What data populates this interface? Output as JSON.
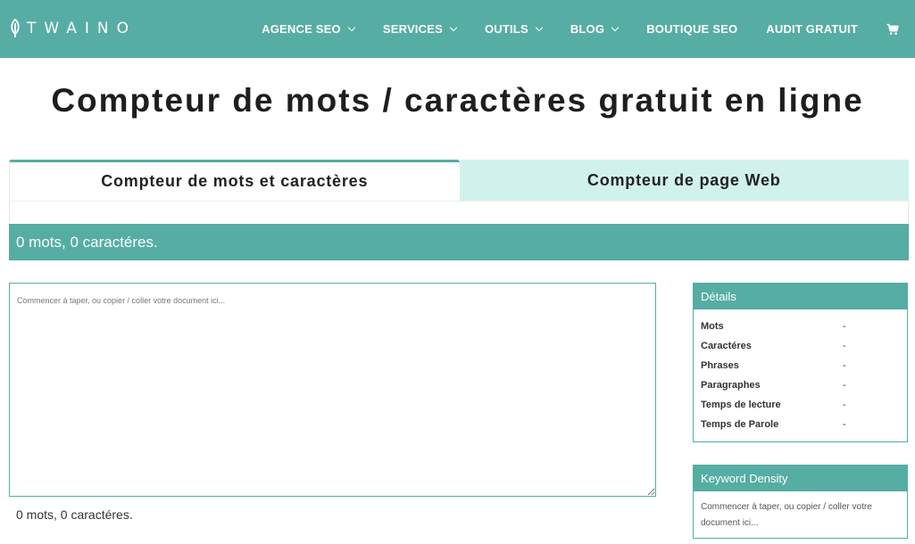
{
  "header": {
    "logo_text": "TWAINO",
    "nav": [
      {
        "label": "AGENCE SEO",
        "dropdown": true
      },
      {
        "label": "SERVICES",
        "dropdown": true
      },
      {
        "label": "OUTILS",
        "dropdown": true
      },
      {
        "label": "BLOG",
        "dropdown": true
      },
      {
        "label": "BOUTIQUE SEO",
        "dropdown": false
      },
      {
        "label": "AUDIT GRATUIT",
        "dropdown": false
      }
    ],
    "cart_icon": "shopping-cart-icon"
  },
  "page": {
    "title": "Compteur de mots / caractères gratuit en ligne"
  },
  "tabs": [
    {
      "label": "Compteur de mots et caractères",
      "active": true
    },
    {
      "label": "Compteur de page Web",
      "active": false
    }
  ],
  "counter": {
    "summary": "0 mots, 0 caractéres.",
    "textarea_placeholder": "Commencer à taper, ou copier / coller votre document ici...",
    "bottom_summary": "0 mots, 0 caractéres."
  },
  "details": {
    "title": "Détails",
    "rows": [
      {
        "label": "Mots",
        "value": "-"
      },
      {
        "label": "Caractéres",
        "value": "-"
      },
      {
        "label": "Phrases",
        "value": "-"
      },
      {
        "label": "Paragraphes",
        "value": "-"
      },
      {
        "label": "Temps de lecture",
        "value": "-"
      },
      {
        "label": "Temps de Parole",
        "value": "-"
      }
    ]
  },
  "keyword_density": {
    "title": "Keyword Density",
    "text": "Commencer à taper, ou copier / coller votre document ici..."
  },
  "colors": {
    "brand": "#56ada3",
    "tab_inactive": "#d1f2ec"
  }
}
